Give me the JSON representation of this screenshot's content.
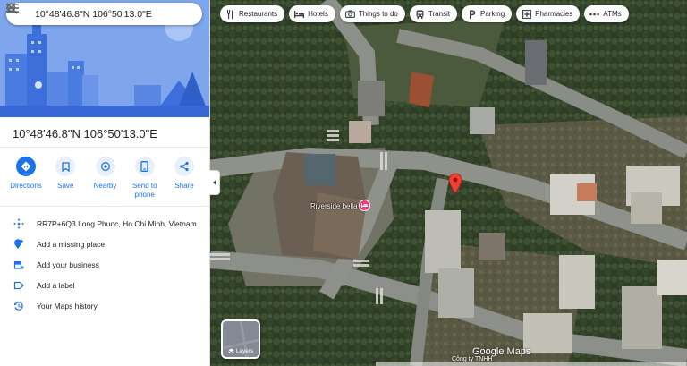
{
  "search": {
    "query": "10°48'46.8\"N 106°50'13.0\"E"
  },
  "place": {
    "title": "10°48'46.8\"N 106°50'13.0\"E"
  },
  "actions": [
    {
      "label": "Directions",
      "icon": "directions-icon"
    },
    {
      "label": "Save",
      "icon": "bookmark-icon"
    },
    {
      "label": "Nearby",
      "icon": "nearby-icon"
    },
    {
      "label": "Send to phone",
      "icon": "phone-icon"
    },
    {
      "label": "Share",
      "icon": "share-icon"
    }
  ],
  "info": [
    {
      "text": "RR7P+6Q3 Long Phuoc, Ho Chi Minh, Vietnam",
      "icon": "plus-code-icon"
    },
    {
      "text": "Add a missing place",
      "icon": "add-place-icon"
    },
    {
      "text": "Add your business",
      "icon": "business-icon"
    },
    {
      "text": "Add a label",
      "icon": "label-icon"
    },
    {
      "text": "Your Maps history",
      "icon": "history-icon"
    }
  ],
  "chips": [
    {
      "label": "Restaurants",
      "icon": "restaurant-icon"
    },
    {
      "label": "Hotels",
      "icon": "hotel-icon"
    },
    {
      "label": "Things to do",
      "icon": "camera-icon"
    },
    {
      "label": "Transit",
      "icon": "transit-icon"
    },
    {
      "label": "Parking",
      "icon": "parking-icon"
    },
    {
      "label": "Pharmacies",
      "icon": "pharmacy-icon"
    },
    {
      "label": "ATMs",
      "icon": "atm-icon"
    }
  ],
  "map": {
    "poi_label": "Riverside bella",
    "layers_label": "Layers",
    "watermark": "Google Maps",
    "company_text": "Công ty TNHH"
  },
  "colors": {
    "accent": "#1a73e8",
    "pin": "#ea4335",
    "poi": "#ec407a",
    "hero": "#6f9ae6"
  }
}
